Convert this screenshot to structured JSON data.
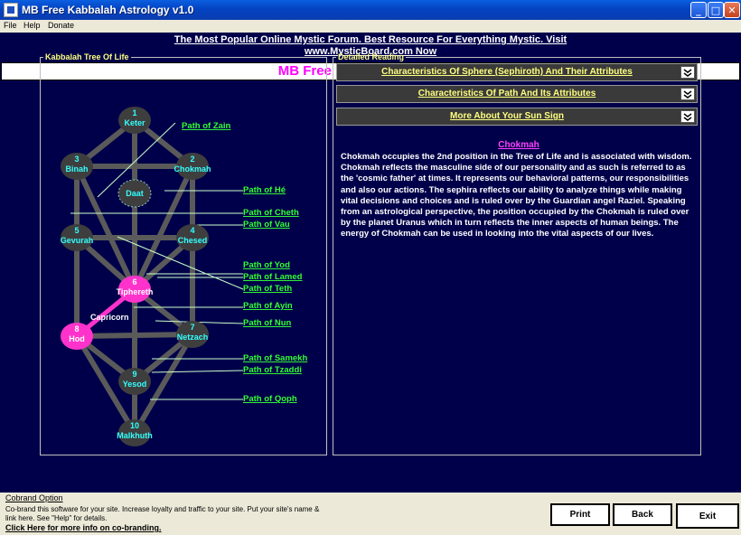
{
  "window": {
    "title": "MB Free Kabbalah Astrology v1.0"
  },
  "menu": {
    "file": "File",
    "help": "Help",
    "donate": "Donate"
  },
  "banner": {
    "line1": "The Most Popular Online Mystic Forum. Best Resource For Everything Mystic. Visit",
    "line2": "www.MysticBoard.com Now"
  },
  "app_title": "MB Free Kabbalah Astrology",
  "tree": {
    "legend": "Kabbalah Tree Of Life",
    "sign_label": "Capricorn",
    "sephiroth": [
      {
        "num": "1",
        "name": "Keter"
      },
      {
        "num": "2",
        "name": "Chokmah"
      },
      {
        "num": "3",
        "name": "Binah"
      },
      {
        "num": "",
        "name": "Daat"
      },
      {
        "num": "4",
        "name": "Chesed"
      },
      {
        "num": "5",
        "name": "Gevurah"
      },
      {
        "num": "6",
        "name": "Tiphereth"
      },
      {
        "num": "7",
        "name": "Netzach"
      },
      {
        "num": "8",
        "name": "Hod"
      },
      {
        "num": "9",
        "name": "Yesod"
      },
      {
        "num": "10",
        "name": "Malkhuth"
      }
    ],
    "paths": [
      "Path of Zain",
      "Path of Hé",
      "Path of Cheth",
      "Path of Vau",
      "Path of Yod",
      "Path of Lamed",
      "Path of Teth",
      "Path of Ayin",
      "Path of Nun",
      "Path of Samekh",
      "Path of Tzaddi",
      "Path of Qoph"
    ],
    "colors": {
      "node": "#3e3e3e",
      "highlight": "#ff33cc",
      "line": "#5a5a5a",
      "label": "#33ff33",
      "node_text": "#33ffff"
    }
  },
  "reading": {
    "legend": "Detailed Reading",
    "sections": [
      "Characteristics Of Sphere (Sephiroth) And Their Attributes",
      "Characteristics Of Path And Its Attributes",
      "More About Your Sun Sign"
    ],
    "title": "Chokmah",
    "text": "Chokmah occupies the 2nd position in the Tree of Life and is associated with wisdom. Chokmah reflects the masculine side of our personality and as such is referred to as the 'cosmic father' at times. It represents our behavioral patterns, our responsibilities and also our actions. The sephira reflects our ability to analyze things while making vital decisions and choices and is ruled over by the Guardian angel Raziel. Speaking from an astrological perspective, the position occupied by the Chokmah is ruled over by the planet Uranus which in turn reflects the inner aspects of human beings. The energy of Chokmah can be used in looking into the vital aspects of our lives."
  },
  "footer": {
    "cobrand_title": "Cobrand Option",
    "cobrand_desc": "Co-brand this software for your site.  Increase loyalty and traffic to your site. Put your site's name & link here. See \"Help\" for details.",
    "cobrand_link": "Click Here for more info on co-branding.",
    "print": "Print",
    "back": "Back",
    "exit": "Exit"
  }
}
